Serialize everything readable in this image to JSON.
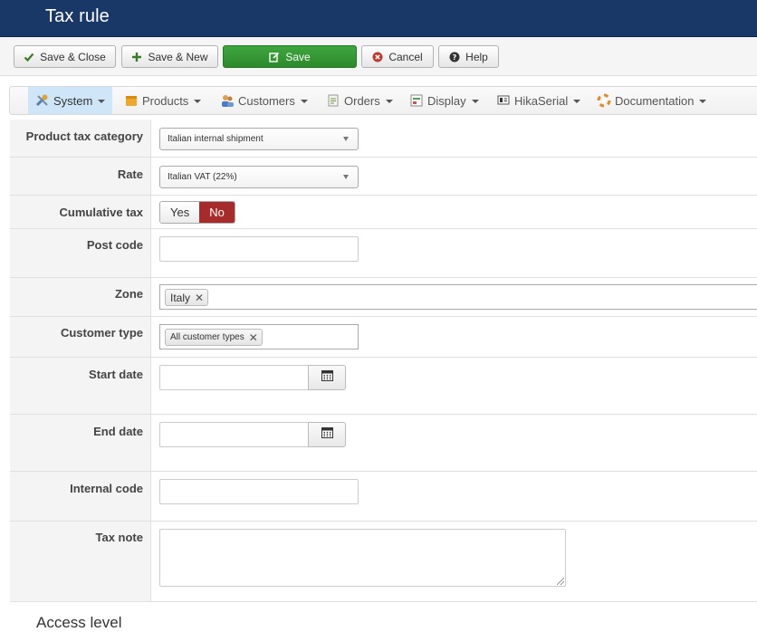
{
  "header": {
    "title": "Tax rule"
  },
  "toolbar": {
    "save_close": "Save & Close",
    "save_new": "Save & New",
    "save": "Save",
    "cancel": "Cancel",
    "help": "Help"
  },
  "nav": {
    "items": [
      {
        "label": "System",
        "icon": "wrench-icon",
        "active": true
      },
      {
        "label": "Products",
        "icon": "box-icon"
      },
      {
        "label": "Customers",
        "icon": "users-icon"
      },
      {
        "label": "Orders",
        "icon": "orders-icon"
      },
      {
        "label": "Display",
        "icon": "display-icon"
      },
      {
        "label": "HikaSerial",
        "icon": "serial-icon"
      },
      {
        "label": "Documentation",
        "icon": "lifebuoy-icon"
      }
    ]
  },
  "form": {
    "product_tax_category": {
      "label": "Product tax category",
      "value": "Italian internal shipment"
    },
    "rate": {
      "label": "Rate",
      "value": "Italian VAT (22%)"
    },
    "cumulative_tax": {
      "label": "Cumulative tax",
      "yes": "Yes",
      "no": "No",
      "selected": "No"
    },
    "post_code": {
      "label": "Post code",
      "value": ""
    },
    "zone": {
      "label": "Zone",
      "tag": "Italy"
    },
    "customer_type": {
      "label": "Customer type",
      "tag": "All customer types"
    },
    "start_date": {
      "label": "Start date",
      "value": ""
    },
    "end_date": {
      "label": "End date",
      "value": ""
    },
    "internal_code": {
      "label": "Internal code",
      "value": ""
    },
    "tax_note": {
      "label": "Tax note",
      "value": ""
    }
  },
  "next_section": {
    "title": "Access level"
  },
  "colors": {
    "header_bg": "#1a3867",
    "save_green": "#2e8f2e",
    "toggle_no_red": "#a72b2b",
    "nav_active": "#cfe6f8"
  }
}
